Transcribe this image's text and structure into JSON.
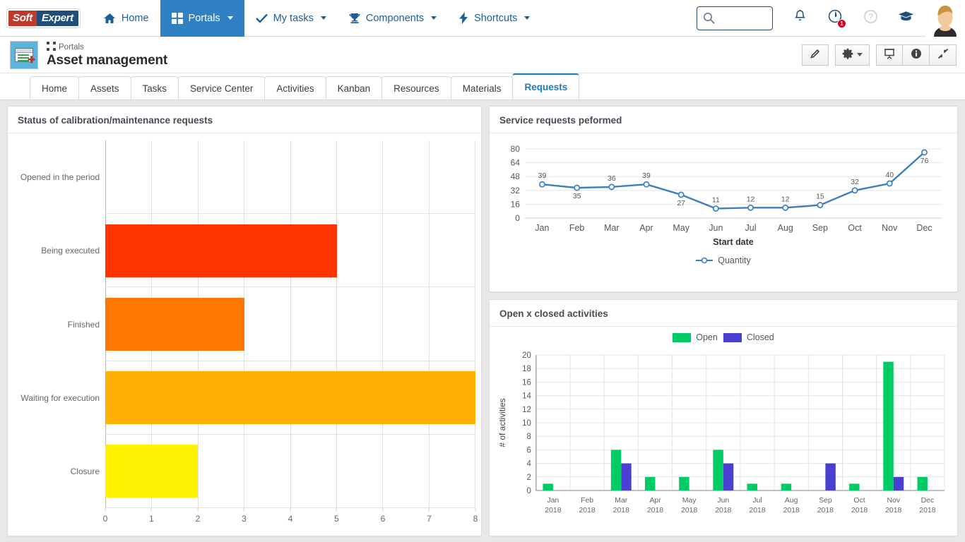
{
  "topnav": {
    "logo_soft": "Soft",
    "logo_expert": "Expert",
    "items": [
      {
        "label": "Home",
        "icon": "home-icon",
        "caret": false,
        "active": false
      },
      {
        "label": "Portals",
        "icon": "grid-icon",
        "caret": true,
        "active": true
      },
      {
        "label": "My tasks",
        "icon": "check-icon",
        "caret": true,
        "active": false
      },
      {
        "label": "Components",
        "icon": "trophy-icon",
        "caret": true,
        "active": false
      },
      {
        "label": "Shortcuts",
        "icon": "bolt-icon",
        "caret": true,
        "active": false
      }
    ],
    "search_placeholder": "",
    "search_value": "",
    "notification_badge": "1",
    "help_label": "?",
    "accent_blue": "#2f81c4",
    "link_blue": "#1b5f99",
    "badge_red": "#d0021b"
  },
  "pagehead": {
    "breadcrumb": "Portals",
    "title": "Asset management",
    "tools": [
      {
        "name": "edit-button",
        "icon": "pencil-icon"
      },
      {
        "name": "settings-button",
        "icon": "gear-icon",
        "caret": true
      },
      {
        "name": "presentation-button",
        "icon": "presentation-icon"
      },
      {
        "name": "info-button",
        "icon": "info-icon"
      },
      {
        "name": "collapse-button",
        "icon": "collapse-arrows-icon"
      }
    ]
  },
  "tabs": [
    {
      "label": "Home",
      "active": false
    },
    {
      "label": "Assets",
      "active": false
    },
    {
      "label": "Tasks",
      "active": false
    },
    {
      "label": "Service Center",
      "active": false
    },
    {
      "label": "Activities",
      "active": false
    },
    {
      "label": "Kanban",
      "active": false
    },
    {
      "label": "Resources",
      "active": false
    },
    {
      "label": "Materials",
      "active": false
    },
    {
      "label": "Requests",
      "active": true
    }
  ],
  "panels": {
    "status_requests_title": "Status of calibration/maintenance requests",
    "service_requests_title": "Service requests peformed",
    "open_closed_title": "Open x closed activities"
  },
  "chart_data": [
    {
      "id": "status-requests",
      "type": "bar",
      "orientation": "horizontal",
      "title": "Status of calibration/maintenance requests",
      "categories": [
        "Opened in the period",
        "Being executed",
        "Finished",
        "Waiting for execution",
        "Closure"
      ],
      "values": [
        0,
        5,
        3,
        8,
        2
      ],
      "colors": [
        "#FF3300",
        "#FF3300",
        "#FF7700",
        "#FFB000",
        "#FFF200"
      ],
      "xlabel": "",
      "ylabel": "",
      "xlim": [
        0,
        8
      ],
      "xticks": [
        0,
        1,
        2,
        3,
        4,
        5,
        6,
        7,
        8
      ],
      "grid": true
    },
    {
      "id": "service-requests-performed",
      "type": "line",
      "title": "Service requests peformed",
      "categories": [
        "Jan",
        "Feb",
        "Mar",
        "Apr",
        "May",
        "Jun",
        "Jul",
        "Aug",
        "Sep",
        "Oct",
        "Nov",
        "Dec"
      ],
      "series": [
        {
          "name": "Quantity",
          "color": "#3b7fbf",
          "values": [
            39,
            35,
            36,
            39,
            27,
            11,
            12,
            12,
            15,
            32,
            40,
            76
          ]
        }
      ],
      "xlabel": "Start date",
      "ylabel": "",
      "ylim": [
        0,
        80
      ],
      "yticks": [
        0,
        16,
        32,
        48,
        64,
        80
      ],
      "data_labels": true,
      "legend": "bottom-center",
      "grid": true
    },
    {
      "id": "open-x-closed-activities",
      "type": "bar",
      "orientation": "vertical",
      "title": "Open x closed activities",
      "categories": [
        "Jan\n2018",
        "Feb\n2018",
        "Mar\n2018",
        "Apr\n2018",
        "May\n2018",
        "Jun\n2018",
        "Jul\n2018",
        "Aug\n2018",
        "Sep\n2018",
        "Oct\n2018",
        "Nov\n2018",
        "Dec\n2018"
      ],
      "category_months": [
        "Jan",
        "Feb",
        "Mar",
        "Apr",
        "May",
        "Jun",
        "Jul",
        "Aug",
        "Sep",
        "Oct",
        "Nov",
        "Dec"
      ],
      "category_year": "2018",
      "series": [
        {
          "name": "Open",
          "color": "#00cc66",
          "values": [
            1,
            0,
            6,
            2,
            2,
            6,
            1,
            1,
            0,
            1,
            19,
            2
          ]
        },
        {
          "name": "Closed",
          "color": "#4a40d0",
          "values": [
            0,
            0,
            4,
            0,
            0,
            4,
            0,
            0,
            4,
            0,
            2,
            0
          ]
        }
      ],
      "xlabel": "",
      "ylabel": "# of activities",
      "ylim": [
        0,
        20
      ],
      "yticks": [
        0,
        2,
        4,
        6,
        8,
        10,
        12,
        14,
        16,
        18,
        20
      ],
      "legend": "top-center",
      "grid": true
    }
  ]
}
